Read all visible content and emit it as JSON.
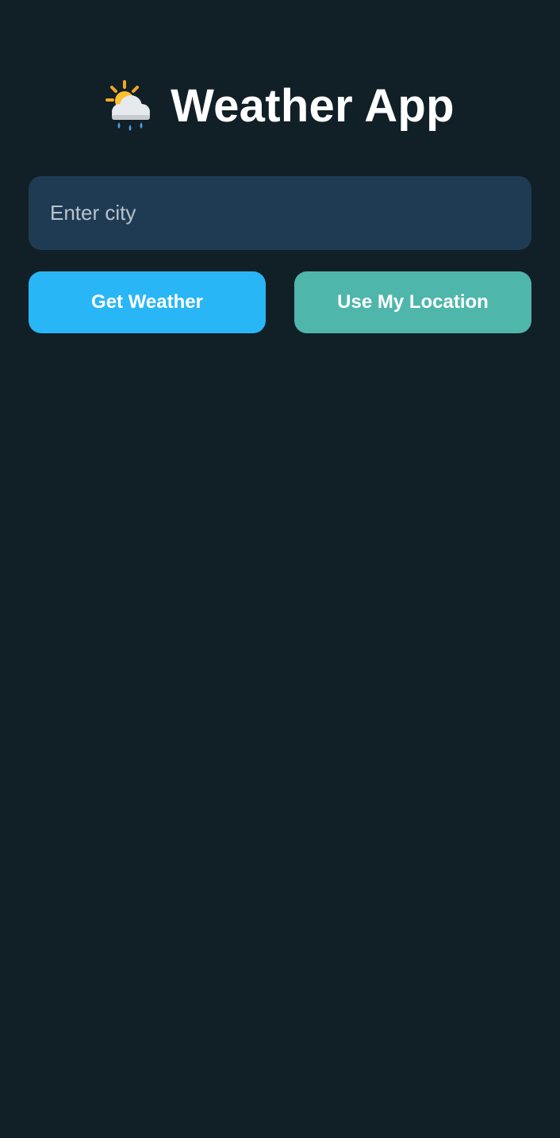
{
  "header": {
    "title": "Weather App",
    "icon": "sun-behind-rain-cloud-icon"
  },
  "search": {
    "placeholder": "Enter city",
    "value": ""
  },
  "buttons": {
    "get_weather_label": "Get Weather",
    "use_location_label": "Use My Location"
  },
  "colors": {
    "background": "#111f27",
    "input_background": "#1f3b54",
    "get_weather_button": "#29b6f6",
    "use_location_button": "#4fb6ac",
    "title_text": "#ffffff",
    "placeholder_text": "#b9c3cc"
  }
}
